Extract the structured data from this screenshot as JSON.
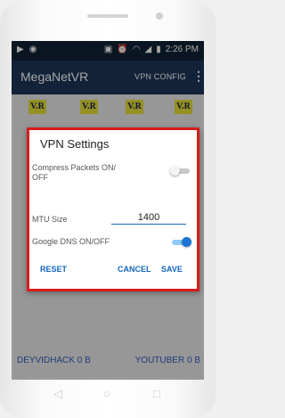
{
  "status": {
    "time": "2:26 PM",
    "icons_left": [
      "youtube-icon",
      "notification-icon"
    ],
    "icons_right": [
      "sim-icon",
      "alarm-icon",
      "wifi-icon",
      "signal-icon",
      "battery-icon"
    ]
  },
  "app": {
    "title": "MegaNetVR",
    "config_label": "VPN CONFIG",
    "menu_glyph": "⋮"
  },
  "vr_badges": [
    "V.R",
    "V.R",
    "V.R",
    "V.R"
  ],
  "dialog": {
    "title": "VPN Settings",
    "compress": {
      "label": "Compress Packets ON/ OFF",
      "checked": false
    },
    "mtu": {
      "label": "MTU Size",
      "value": "1400"
    },
    "dns": {
      "label": "Google DNS ON/OFF",
      "checked": true
    },
    "reset_label": "RESET",
    "cancel_label": "CANCEL",
    "save_label": "SAVE"
  },
  "footer": {
    "left": "DEYVIDHACK 0 B",
    "right": "YOUTUBER 0 B"
  },
  "colors": {
    "appbar": "#1c3556",
    "statusbar": "#0f2233",
    "badge": "#e3de36",
    "accent": "#1565c0",
    "highlight": "#d71b1b"
  }
}
